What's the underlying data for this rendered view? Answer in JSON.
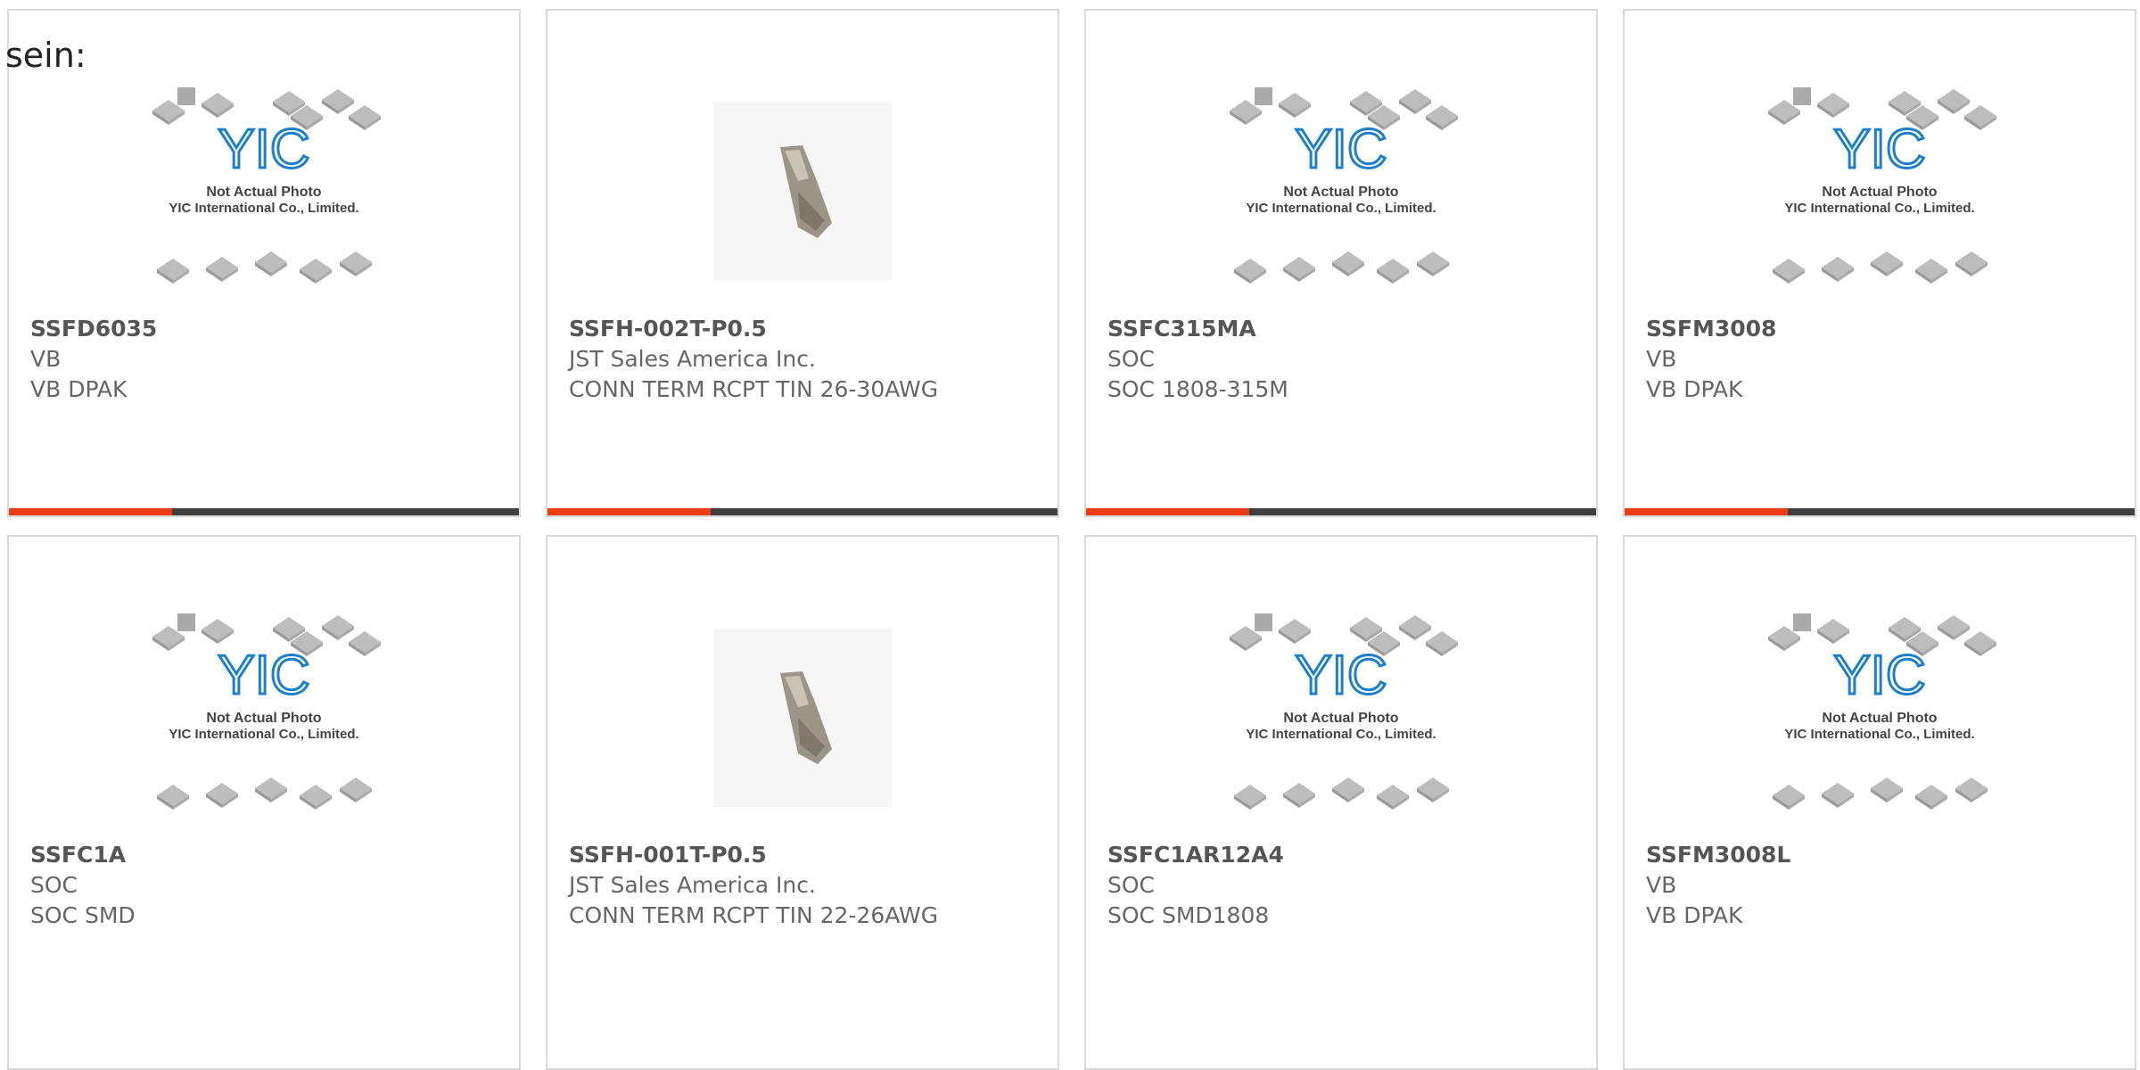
{
  "header": {
    "title": "sein:"
  },
  "colors": {
    "accent": "#ea3d16",
    "bar": "#3f3f3f",
    "yic_blue": "#1b7fcc"
  },
  "placeholder": {
    "line1": "Not Actual Photo",
    "line2": "YIC International Co., Limited.",
    "logo": "YIC"
  },
  "products": [
    {
      "part": "SSFD6035",
      "maker": "VB",
      "desc": "VB DPAK",
      "image": "placeholder-logo"
    },
    {
      "part": "SSFH-002T-P0.5",
      "maker": "JST Sales America Inc.",
      "desc": "CONN TERM RCPT TIN 26-30AWG",
      "image": "crimp-terminal-photo"
    },
    {
      "part": "SSFC315MA",
      "maker": "SOC",
      "desc": "SOC 1808-315M",
      "image": "placeholder-logo"
    },
    {
      "part": "SSFM3008",
      "maker": "VB",
      "desc": "VB DPAK",
      "image": "placeholder-logo"
    },
    {
      "part": "SSFC1A",
      "maker": "SOC",
      "desc": "SOC SMD",
      "image": "placeholder-logo"
    },
    {
      "part": "SSFH-001T-P0.5",
      "maker": "JST Sales America Inc.",
      "desc": "CONN TERM RCPT TIN 22-26AWG",
      "image": "crimp-terminal-photo"
    },
    {
      "part": "SSFC1AR12A4",
      "maker": "SOC",
      "desc": "SOC SMD1808",
      "image": "placeholder-logo"
    },
    {
      "part": "SSFM3008L",
      "maker": "VB",
      "desc": "VB DPAK",
      "image": "placeholder-logo"
    }
  ]
}
